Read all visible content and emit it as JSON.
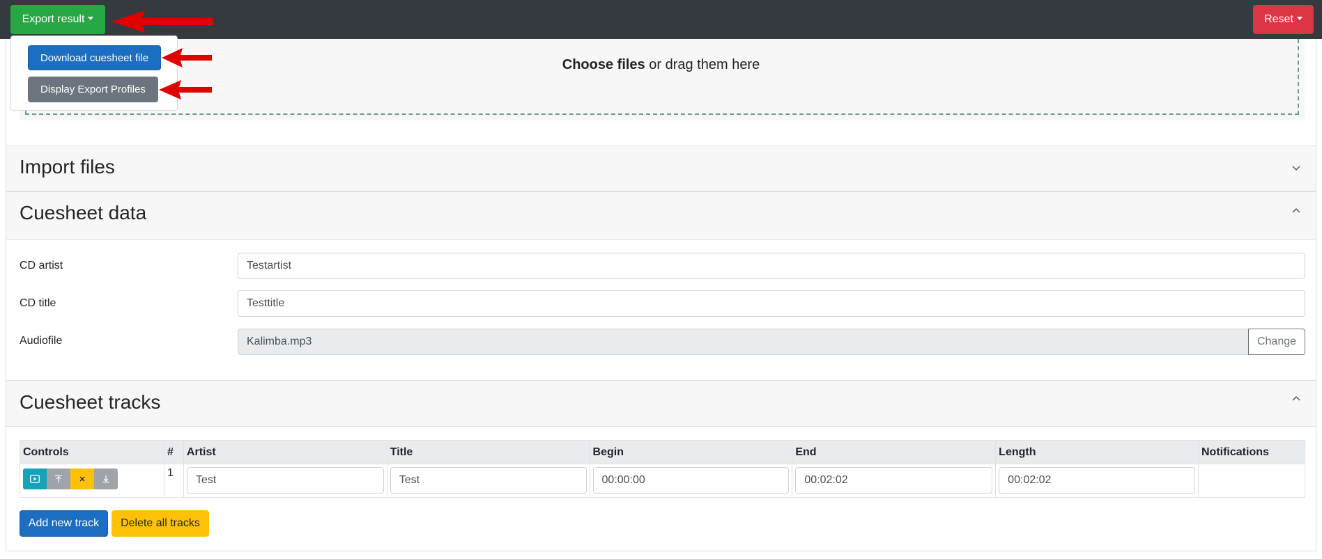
{
  "topbar": {
    "export_label": "Export result",
    "reset_label": "Reset"
  },
  "export_menu": {
    "download_label": "Download cuesheet file",
    "profiles_label": "Display Export Profiles"
  },
  "dropzone": {
    "choose_label": "Choose files",
    "drag_text": " or drag them here"
  },
  "sections": {
    "import_title": "Import files",
    "data_title": "Cuesheet data",
    "tracks_title": "Cuesheet tracks"
  },
  "cuesheet_data": {
    "artist_label": "CD artist",
    "artist_value": "Testartist",
    "title_label": "CD title",
    "title_value": "Testtitle",
    "audiofile_label": "Audiofile",
    "audiofile_value": "Kalimba.mp3",
    "change_label": "Change"
  },
  "tracks_table": {
    "headers": [
      "Controls",
      "#",
      "Artist",
      "Title",
      "Begin",
      "End",
      "Length",
      "Notifications"
    ],
    "rows": [
      {
        "num": "1",
        "artist": "Test",
        "title": "Test",
        "begin": "00:00:00",
        "end": "00:02:02",
        "length": "00:02:02",
        "notifications": ""
      }
    ]
  },
  "track_actions": {
    "add_label": "Add new track",
    "delete_all_label": "Delete all tracks"
  },
  "icons": {
    "play": "play-icon",
    "move_up": "move-up-icon",
    "delete": "close-icon",
    "move_down": "move-down-icon",
    "annotation": "red-arrow-annotation"
  },
  "colors": {
    "topbar": "#343a40",
    "success": "#28a745",
    "danger": "#dc3545",
    "primary": "#1b6ec2",
    "secondary": "#6c757d",
    "warning": "#ffc107",
    "info": "#17a2b8",
    "annotation_arrow": "#e00000"
  }
}
